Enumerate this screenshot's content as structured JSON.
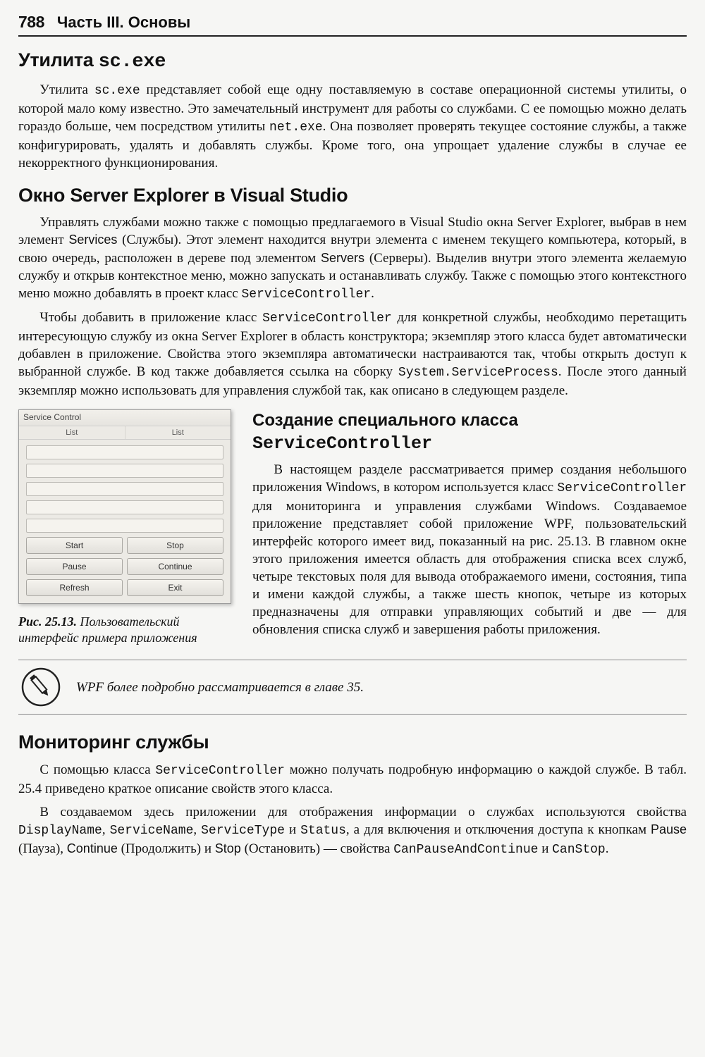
{
  "header": {
    "page_number": "788",
    "part_label": "Часть III. Основы"
  },
  "sec1": {
    "title_a": "Утилита ",
    "title_b": "sc.exe",
    "p1_a": "Утилита ",
    "p1_code1": "sc.exe",
    "p1_b": " представляет собой еще одну поставляемую в составе операционной системы утилиты, о которой мало кому известно. Это замечательный инструмент для работы со службами. С ее помощью можно делать гораздо больше, чем посредством утилиты ",
    "p1_code2": "net.exe",
    "p1_c": ". Она позволяет проверять текущее состояние службы, а также конфигурировать, удалять и добавлять службы. Кроме того, она упрощает удаление службы в случае ее некорректного функционирования."
  },
  "sec2": {
    "title": "Окно Server Explorer в Visual Studio",
    "p1_a": "Управлять службами можно также с помощью предлагаемого в Visual Studio окна Server Explorer, выбрав в нем элемент ",
    "p1_ui1": "Services",
    "p1_b": " (Службы). Этот элемент находится внутри элемента с именем текущего компьютера, который, в свою очередь, расположен в дереве под элементом ",
    "p1_ui2": "Servers",
    "p1_c": " (Серверы). Выделив внутри этого элемента желаемую службу и открыв контекстное меню, можно запускать и останавливать службу. Также с помощью этого контекстного меню можно добавлять в проект класс ",
    "p1_code1": "ServiceController",
    "p1_d": ".",
    "p2_a": "Чтобы добавить в приложение класс ",
    "p2_code1": "ServiceController",
    "p2_b": " для конкретной службы, необходимо перетащить интересующую службу из окна Server Explorer в область конструктора; экземпляр этого класса будет автоматически добавлен в приложение. Свойства этого экземпляра автоматически настраиваются так, чтобы открыть доступ к выбранной службе. В код также добавляется ссылка на сборку ",
    "p2_code2": "System.ServiceProcess",
    "p2_c": ". После этого данный экземпляр можно использовать для управления службой так, как описано в следующем разделе."
  },
  "sec3": {
    "title_a": "Создание специального класса ",
    "title_code": "ServiceController",
    "p1_a": "В настоящем разделе рассматривается пример создания небольшого приложения Windows, в котором используется класс ",
    "p1_code1": "ServiceController",
    "p1_b": " для мониторинга и управления службами Windows. Создаваемое приложение представляет собой приложение WPF, пользовательский интерфейс которого имеет вид, показанный на рис. 25.13. В главном окне этого приложения имеется область для отображения списка всех служб, четыре текстовых поля для вывода отображаемого имени, состояния, типа и имени каждой службы, а также шесть кнопок, четыре из которых предназначены для отправки управляющих событий и две — для обновления списка служб и завершения работы приложения."
  },
  "fig": {
    "window_title": "Service Control",
    "tab1": "List",
    "tab2": "List",
    "buttons": {
      "start": "Start",
      "stop": "Stop",
      "pause": "Pause",
      "continue": "Continue",
      "refresh": "Refresh",
      "exit": "Exit"
    },
    "caption_label": "Рис. 25.13.",
    "caption_text": " Пользовательский интерфейс примера приложения"
  },
  "note": {
    "text": "WPF более подробно рассматривается в главе 35."
  },
  "sec4": {
    "title": "Мониторинг службы",
    "p1_a": "С помощью класса ",
    "p1_code1": "ServiceController",
    "p1_b": " можно получать подробную информацию о каждой службе. В табл. 25.4 приведено краткое описание свойств этого класса.",
    "p2_a": "В создаваемом здесь приложении для отображения информации о службах используются свойства ",
    "p2_code1": "DisplayName",
    "p2_b": ", ",
    "p2_code2": "ServiceName",
    "p2_c": ", ",
    "p2_code3": "ServiceType",
    "p2_d": " и ",
    "p2_code4": "Status",
    "p2_e": ", а для включения и отключения доступа к кнопкам ",
    "p2_ui1": "Pause",
    "p2_f": " (Пауза), ",
    "p2_ui2": "Continue",
    "p2_g": " (Продолжить) и ",
    "p2_ui3": "Stop",
    "p2_h": " (Остановить) — свойства ",
    "p2_code5": "CanPauseAndContinue",
    "p2_i": " и ",
    "p2_code6": "CanStop",
    "p2_j": "."
  }
}
